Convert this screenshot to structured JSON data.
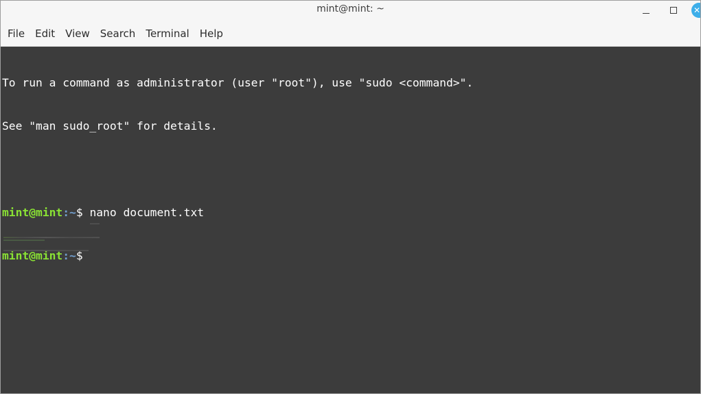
{
  "window": {
    "title": "mint@mint: ~"
  },
  "menu": {
    "items": [
      "File",
      "Edit",
      "View",
      "Search",
      "Terminal",
      "Help"
    ]
  },
  "terminal": {
    "info_line_1": "To run a command as administrator (user \"root\"), use \"sudo <command>\".",
    "info_line_2": "See \"man sudo_root\" for details.",
    "prompts": [
      {
        "user": "mint@mint",
        "path": ":~",
        "sign": "$ ",
        "command": "nano document.txt"
      },
      {
        "user": "mint@mint",
        "path": ":~",
        "sign": "$",
        "command": ""
      }
    ]
  },
  "colors": {
    "terminal_bg": "#3c3c3c",
    "prompt_user": "#8ae234",
    "prompt_path": "#729fcf",
    "close_button": "#3daee9"
  },
  "icons": {
    "minimize": "minimize-icon",
    "maximize": "maximize-icon",
    "close": "close-icon"
  }
}
